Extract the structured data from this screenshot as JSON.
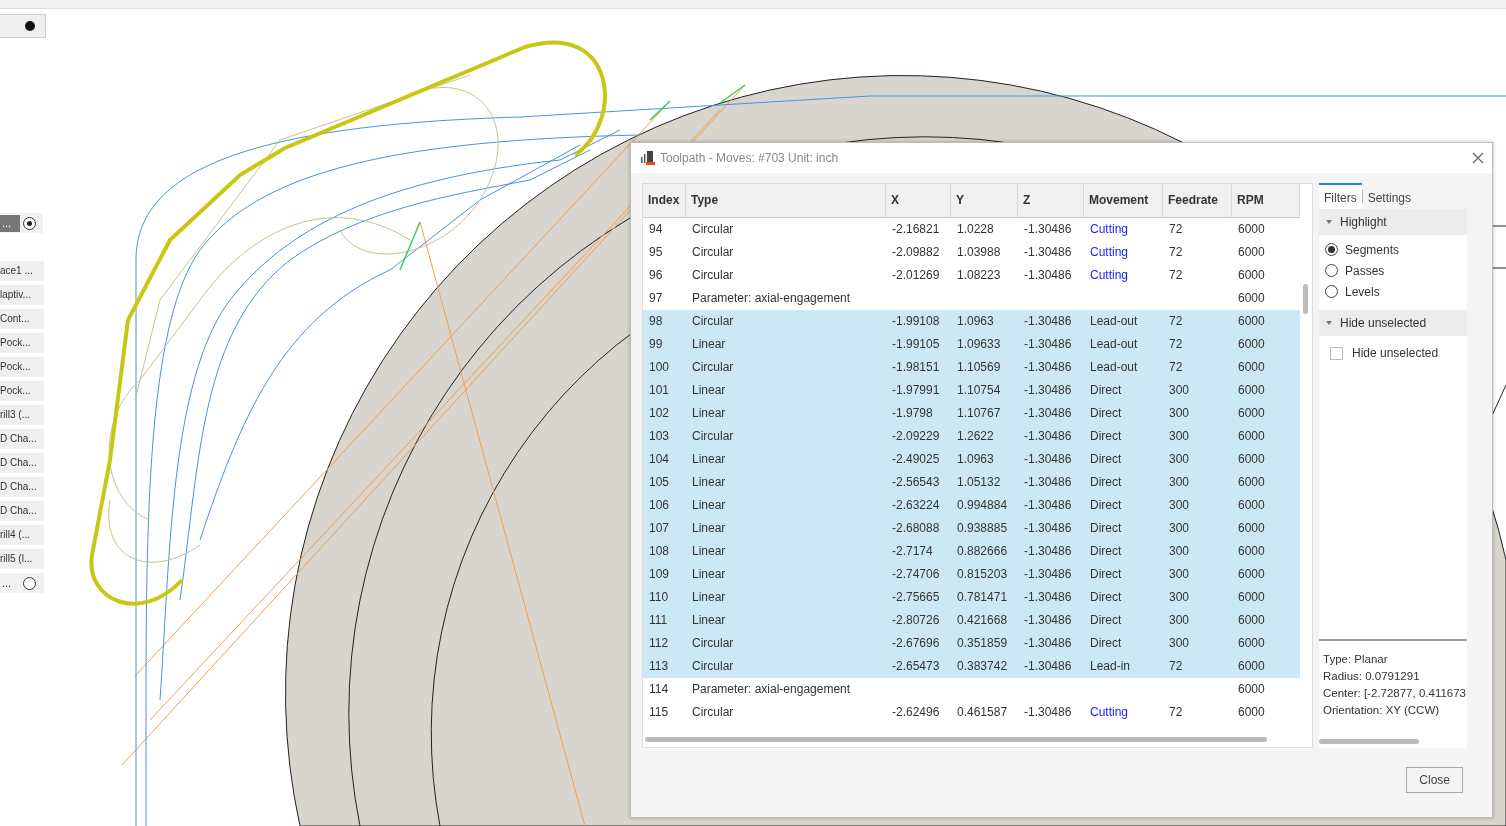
{
  "sidebar": {
    "items": [
      {
        "kind": "collapse"
      },
      {
        "kind": "radio",
        "label": "...",
        "selected": true
      },
      {
        "kind": "op",
        "label": "ace1 ..."
      },
      {
        "kind": "op",
        "label": "laptiv..."
      },
      {
        "kind": "op",
        "label": "Cont..."
      },
      {
        "kind": "op",
        "label": "Pock..."
      },
      {
        "kind": "op",
        "label": "Pock..."
      },
      {
        "kind": "op",
        "label": "Pock..."
      },
      {
        "kind": "op",
        "label": "rill3 (..."
      },
      {
        "kind": "op",
        "label": "D Cha..."
      },
      {
        "kind": "op",
        "label": "D Cha..."
      },
      {
        "kind": "op",
        "label": "D Cha..."
      },
      {
        "kind": "op",
        "label": "D Cha..."
      },
      {
        "kind": "op",
        "label": "rill4 (..."
      },
      {
        "kind": "op",
        "label": "rill5 (l..."
      },
      {
        "kind": "radio",
        "label": "...",
        "selected": false
      }
    ]
  },
  "dialog": {
    "title": "Toolpath - Moves: #703 Unit: inch",
    "table": {
      "columns": [
        "Index",
        "Type",
        "X",
        "Y",
        "Z",
        "Movement",
        "Feedrate",
        "RPM"
      ],
      "rows": [
        {
          "kind": "move",
          "selected": false,
          "cells": [
            "94",
            "Circular",
            "-2.16821",
            "1.0228",
            "-1.30486",
            "Cutting",
            "72",
            "6000"
          ],
          "color": "#1a1aff"
        },
        {
          "kind": "move",
          "selected": false,
          "cells": [
            "95",
            "Circular",
            "-2.09882",
            "1.03988",
            "-1.30486",
            "Cutting",
            "72",
            "6000"
          ],
          "color": "#1a1aff"
        },
        {
          "kind": "move",
          "selected": false,
          "cells": [
            "96",
            "Circular",
            "-2.01269",
            "1.08223",
            "-1.30486",
            "Cutting",
            "72",
            "6000"
          ],
          "color": "#1a1aff"
        },
        {
          "kind": "parameter",
          "selected": false,
          "cells": [
            "97",
            "Parameter: axial-engagement",
            "6000"
          ]
        },
        {
          "kind": "move",
          "selected": true,
          "cells": [
            "98",
            "Circular",
            "-1.99108",
            "1.0963",
            "-1.30486",
            "Lead-out",
            "72",
            "6000"
          ],
          "color": "#333333"
        },
        {
          "kind": "move",
          "selected": true,
          "cells": [
            "99",
            "Linear",
            "-1.99105",
            "1.09633",
            "-1.30486",
            "Lead-out",
            "72",
            "6000"
          ],
          "color": "#333333"
        },
        {
          "kind": "move",
          "selected": true,
          "cells": [
            "100",
            "Circular",
            "-1.98151",
            "1.10569",
            "-1.30486",
            "Lead-out",
            "72",
            "6000"
          ],
          "color": "#333333"
        },
        {
          "kind": "move",
          "selected": true,
          "cells": [
            "101",
            "Linear",
            "-1.97991",
            "1.10754",
            "-1.30486",
            "Direct",
            "300",
            "6000"
          ],
          "color": "#333333"
        },
        {
          "kind": "move",
          "selected": true,
          "cells": [
            "102",
            "Linear",
            "-1.9798",
            "1.10767",
            "-1.30486",
            "Direct",
            "300",
            "6000"
          ],
          "color": "#333333"
        },
        {
          "kind": "move",
          "selected": true,
          "cells": [
            "103",
            "Circular",
            "-2.09229",
            "1.2622",
            "-1.30486",
            "Direct",
            "300",
            "6000"
          ],
          "color": "#333333"
        },
        {
          "kind": "move",
          "selected": true,
          "cells": [
            "104",
            "Linear",
            "-2.49025",
            "1.0963",
            "-1.30486",
            "Direct",
            "300",
            "6000"
          ],
          "color": "#333333"
        },
        {
          "kind": "move",
          "selected": true,
          "cells": [
            "105",
            "Linear",
            "-2.56543",
            "1.05132",
            "-1.30486",
            "Direct",
            "300",
            "6000"
          ],
          "color": "#333333"
        },
        {
          "kind": "move",
          "selected": true,
          "cells": [
            "106",
            "Linear",
            "-2.63224",
            "0.994884",
            "-1.30486",
            "Direct",
            "300",
            "6000"
          ],
          "color": "#333333"
        },
        {
          "kind": "move",
          "selected": true,
          "cells": [
            "107",
            "Linear",
            "-2.68088",
            "0.938885",
            "-1.30486",
            "Direct",
            "300",
            "6000"
          ],
          "color": "#333333"
        },
        {
          "kind": "move",
          "selected": true,
          "cells": [
            "108",
            "Linear",
            "-2.7174",
            "0.882666",
            "-1.30486",
            "Direct",
            "300",
            "6000"
          ],
          "color": "#333333"
        },
        {
          "kind": "move",
          "selected": true,
          "cells": [
            "109",
            "Linear",
            "-2.74706",
            "0.815203",
            "-1.30486",
            "Direct",
            "300",
            "6000"
          ],
          "color": "#333333"
        },
        {
          "kind": "move",
          "selected": true,
          "cells": [
            "110",
            "Linear",
            "-2.75665",
            "0.781471",
            "-1.30486",
            "Direct",
            "300",
            "6000"
          ],
          "color": "#333333"
        },
        {
          "kind": "move",
          "selected": true,
          "cells": [
            "111",
            "Linear",
            "-2.80726",
            "0.421668",
            "-1.30486",
            "Direct",
            "300",
            "6000"
          ],
          "color": "#333333"
        },
        {
          "kind": "move",
          "selected": true,
          "cells": [
            "112",
            "Circular",
            "-2.67696",
            "0.351859",
            "-1.30486",
            "Direct",
            "300",
            "6000"
          ],
          "color": "#333333"
        },
        {
          "kind": "move",
          "selected": true,
          "cells": [
            "113",
            "Circular",
            "-2.65473",
            "0.383742",
            "-1.30486",
            "Lead-in",
            "72",
            "6000"
          ],
          "color": "#333333"
        },
        {
          "kind": "parameter",
          "selected": false,
          "cells": [
            "114",
            "Parameter: axial-engagement",
            "6000"
          ]
        },
        {
          "kind": "move",
          "selected": false,
          "cells": [
            "115",
            "Circular",
            "-2.62496",
            "0.461587",
            "-1.30486",
            "Cutting",
            "72",
            "6000"
          ],
          "color": "#1a1aff"
        }
      ]
    },
    "panel": {
      "tabs": [
        {
          "label": "Filters",
          "selected": true
        },
        {
          "label": "Settings",
          "selected": false
        }
      ],
      "sections": [
        {
          "title": "Highlight",
          "expanded": true,
          "kind": "radios",
          "options": [
            {
              "label": "Segments",
              "selected": true
            },
            {
              "label": "Passes",
              "selected": false
            },
            {
              "label": "Levels",
              "selected": false
            }
          ]
        },
        {
          "title": "Hide unselected",
          "expanded": true,
          "kind": "checkboxes",
          "options": [
            {
              "label": "Hide unselected",
              "checked": false
            }
          ]
        }
      ],
      "info": [
        "Type: Planar",
        "Radius: 0.0791291",
        "Center: [-2.72877, 0.411673",
        "Orientation: XY (CCW)"
      ]
    },
    "buttons": [
      "Close"
    ]
  }
}
